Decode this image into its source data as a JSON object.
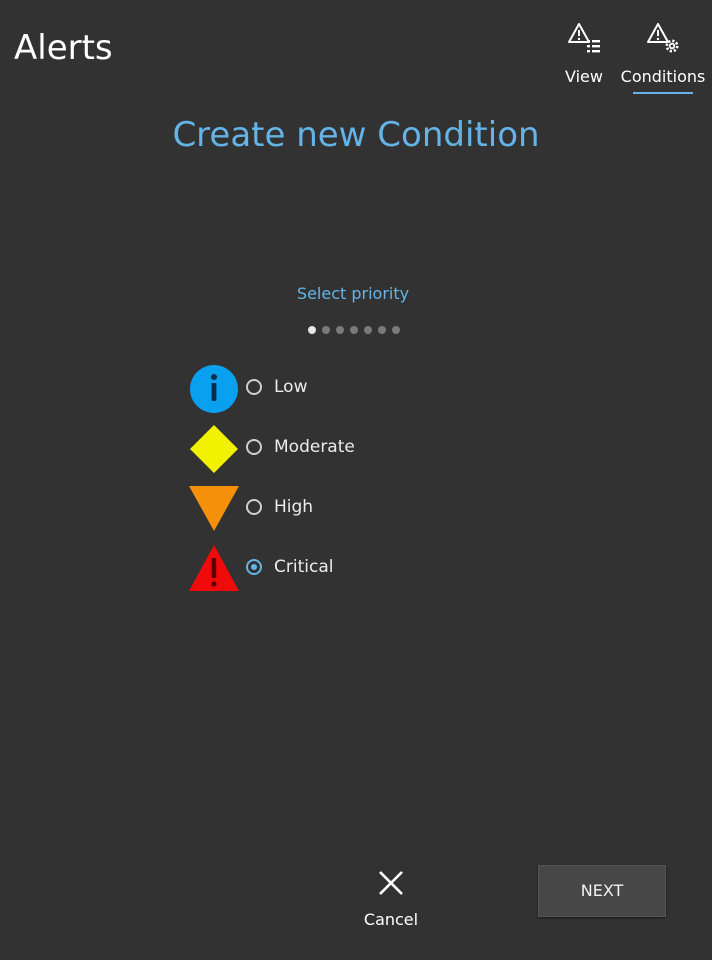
{
  "app": {
    "title": "Alerts"
  },
  "nav": {
    "tabs": [
      {
        "label": "View",
        "icon": "alert-list-icon",
        "active": false
      },
      {
        "label": "Conditions",
        "icon": "alert-settings-icon",
        "active": true
      }
    ],
    "accent_color": "#64b4e8"
  },
  "main": {
    "heading": "Create new Condition",
    "step_label": "Select priority",
    "step": {
      "current": 1,
      "total": 7
    },
    "priorities": [
      {
        "label": "Low",
        "icon": "info-circle-icon",
        "color": "#0aa0f0",
        "selected": false
      },
      {
        "label": "Moderate",
        "icon": "diamond-icon",
        "color": "#f2f200",
        "selected": false
      },
      {
        "label": "High",
        "icon": "down-triangle-icon",
        "color": "#f5900a",
        "selected": false
      },
      {
        "label": "Critical",
        "icon": "exclamation-triangle-icon",
        "color": "#f00a0a",
        "selected": true
      }
    ]
  },
  "footer": {
    "cancel_label": "Cancel",
    "next_label": "NEXT"
  },
  "colors": {
    "background": "#323232",
    "accent": "#64b4e8"
  }
}
